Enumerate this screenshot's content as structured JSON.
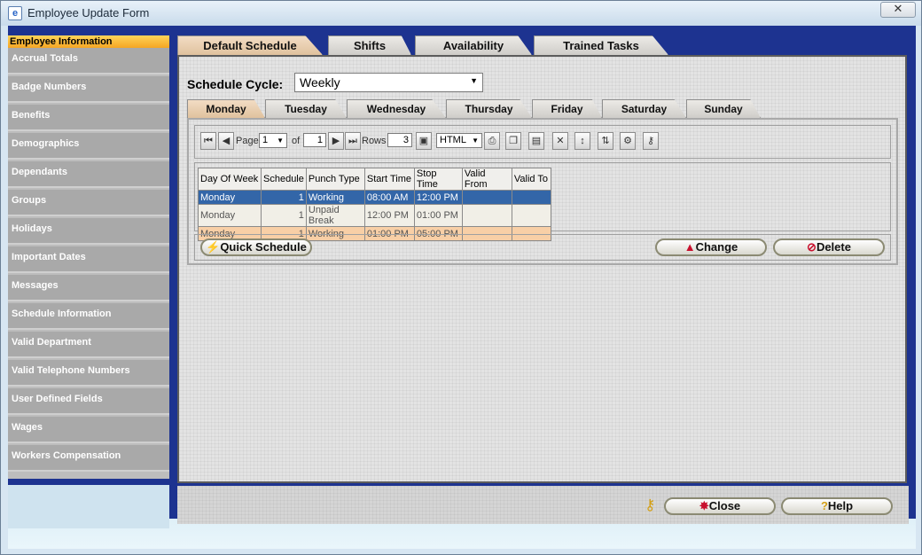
{
  "window": {
    "title": "Employee Update Form",
    "close_glyph": "✕"
  },
  "sidebar": {
    "items": [
      {
        "label": "Employee Information",
        "active": true
      },
      {
        "label": "Accrual Totals"
      },
      {
        "label": "Badge Numbers"
      },
      {
        "label": "Benefits"
      },
      {
        "label": "Demographics"
      },
      {
        "label": "Dependants"
      },
      {
        "label": "Groups"
      },
      {
        "label": "Holidays"
      },
      {
        "label": "Important Dates"
      },
      {
        "label": "Messages"
      },
      {
        "label": "Schedule Information"
      },
      {
        "label": "Valid Department"
      },
      {
        "label": "Valid Telephone Numbers"
      },
      {
        "label": "User Defined Fields"
      },
      {
        "label": "Wages"
      },
      {
        "label": "Workers Compensation"
      }
    ]
  },
  "tabs": [
    {
      "label": "Default Schedule",
      "active": true
    },
    {
      "label": "Shifts"
    },
    {
      "label": "Availability"
    },
    {
      "label": "Trained Tasks"
    }
  ],
  "schedule_cycle": {
    "label": "Schedule Cycle:",
    "value": "Weekly"
  },
  "day_tabs": [
    {
      "label": "Monday",
      "active": true
    },
    {
      "label": "Tuesday"
    },
    {
      "label": "Wednesday"
    },
    {
      "label": "Thursday"
    },
    {
      "label": "Friday"
    },
    {
      "label": "Saturday"
    },
    {
      "label": "Sunday"
    }
  ],
  "toolbar": {
    "page_label": "Page",
    "page_value": "1",
    "of_label": "of",
    "total_pages": "1",
    "rows_label": "Rows",
    "rows_value": "3",
    "format_value": "HTML"
  },
  "table": {
    "columns": [
      "Day Of Week",
      "Schedule",
      "Punch Type",
      "Start Time",
      "Stop Time",
      "Valid From",
      "Valid To"
    ],
    "rows": [
      [
        "Monday",
        "1",
        "Working",
        "08:00 AM",
        "12:00 PM",
        "",
        ""
      ],
      [
        "Monday",
        "1",
        "Unpaid Break",
        "12:00 PM",
        "01:00 PM",
        "",
        ""
      ],
      [
        "Monday",
        "1",
        "Working",
        "01:00 PM",
        "05:00 PM",
        "",
        ""
      ]
    ]
  },
  "actions": {
    "quick_schedule": "Quick Schedule",
    "change": "Change",
    "delete": "Delete"
  },
  "footer": {
    "close": "Close",
    "help": "Help"
  },
  "colors": {
    "accent": "#1d3390",
    "selected_row": "#3366a8",
    "highlight_row": "#f8cfa6"
  }
}
